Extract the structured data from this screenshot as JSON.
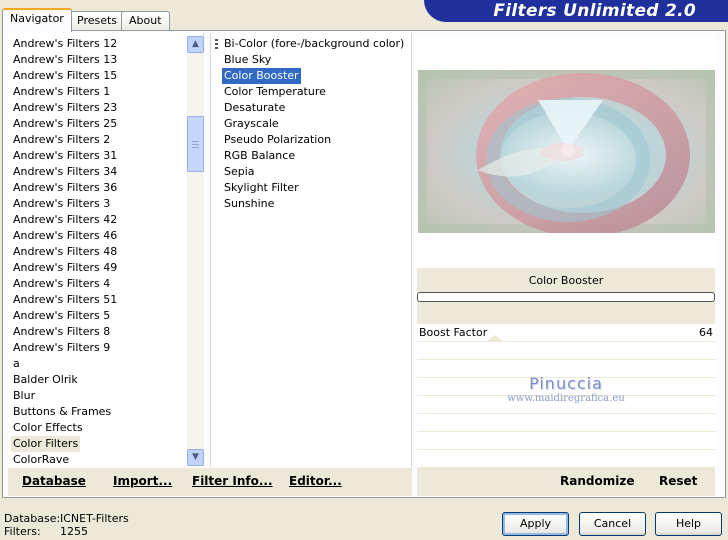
{
  "app": {
    "title": "Filters Unlimited 2.0"
  },
  "tabs": [
    {
      "label": "Navigator",
      "active": true
    },
    {
      "label": "Presets",
      "active": false
    },
    {
      "label": "About",
      "active": false
    }
  ],
  "categories": {
    "items": [
      "Andrew's Filters 12",
      "Andrew's Filters 13",
      "Andrew's Filters 15",
      "Andrew's Filters 1",
      "Andrew's Filters 23",
      "Andrew's Filters 25",
      "Andrew's Filters 2",
      "Andrew's Filters 31",
      "Andrew's Filters 34",
      "Andrew's Filters 36",
      "Andrew's Filters 3",
      "Andrew's Filters 42",
      "Andrew's Filters 46",
      "Andrew's Filters 48",
      "Andrew's Filters 49",
      "Andrew's Filters 4",
      "Andrew's Filters 51",
      "Andrew's Filters 5",
      "Andrew's Filters 8",
      "Andrew's Filters 9",
      "a",
      "Balder Olrik",
      "Blur",
      "Buttons & Frames",
      "Color Effects",
      "Color Filters",
      "ColorRave"
    ],
    "selected": "Color Filters"
  },
  "filters": {
    "items": [
      "Bi-Color (fore-/background color)",
      "Blue Sky",
      "Color Booster",
      "Color Temperature",
      "Desaturate",
      "Grayscale",
      "Pseudo Polarization",
      "RGB Balance",
      "Sepia",
      "Skylight Filter",
      "Sunshine"
    ],
    "selected": "Color Booster"
  },
  "filter_panel": {
    "title": "Color Booster",
    "params": [
      {
        "label": "Boost Factor",
        "value": "64"
      }
    ],
    "watermark": {
      "line1": "Pinuccia",
      "line2": "www.maidiregrafica.eu"
    }
  },
  "links": {
    "database": "Database",
    "import": "Import...",
    "filter_info": "Filter Info...",
    "editor": "Editor...",
    "randomize": "Randomize",
    "reset": "Reset"
  },
  "status": {
    "database_label": "Database:",
    "database_value": "ICNET-Filters",
    "filters_label": "Filters:",
    "filters_value": "1255"
  },
  "buttons": {
    "apply": "Apply",
    "cancel": "Cancel",
    "help": "Help"
  },
  "icons": {
    "scroll_up": "scroll-up-icon",
    "scroll_down": "scroll-down-icon"
  },
  "colors": {
    "brand": "#1f2f9c",
    "selection": "#316ac5",
    "window_bg": "#ece9d8"
  }
}
